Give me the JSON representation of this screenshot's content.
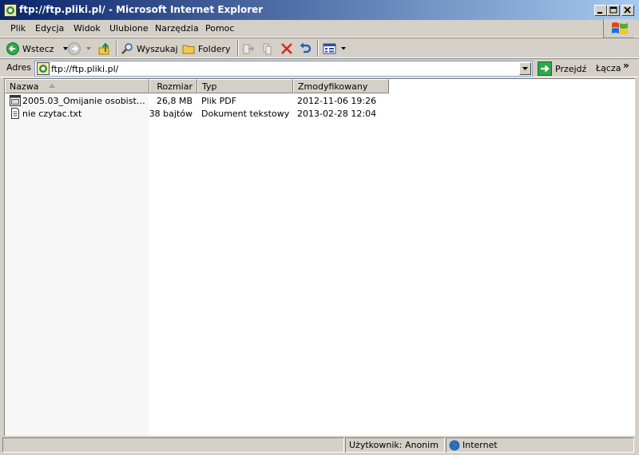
{
  "window": {
    "title": "ftp://ftp.pliki.pl/ - Microsoft Internet Explorer"
  },
  "menu": {
    "items": [
      "Plik",
      "Edycja",
      "Widok",
      "Ulubione",
      "Narzędzia",
      "Pomoc"
    ]
  },
  "toolbar": {
    "back_label": "Wstecz",
    "search_label": "Wyszukaj",
    "folders_label": "Foldery"
  },
  "address": {
    "label": "Adres",
    "url": "ftp://ftp.pliki.pl/",
    "go_label": "Przejdź",
    "links_label": "Łącza"
  },
  "columns": {
    "name": "Nazwa",
    "size": "Rozmiar",
    "type": "Typ",
    "modified": "Zmodyfikowany"
  },
  "files": [
    {
      "name": "2005.03_Omijanie osobistych ...",
      "size": "26,8 MB",
      "type": "Plik PDF",
      "modified": "2012-11-06 19:26",
      "icon": "pdf-file-icon"
    },
    {
      "name": "nie czytac.txt",
      "size": "38 bajtów",
      "type": "Dokument tekstowy",
      "modified": "2013-02-28 12:04",
      "icon": "text-file-icon"
    }
  ],
  "status": {
    "user": "Użytkownik: Anonim",
    "zone": "Internet"
  }
}
